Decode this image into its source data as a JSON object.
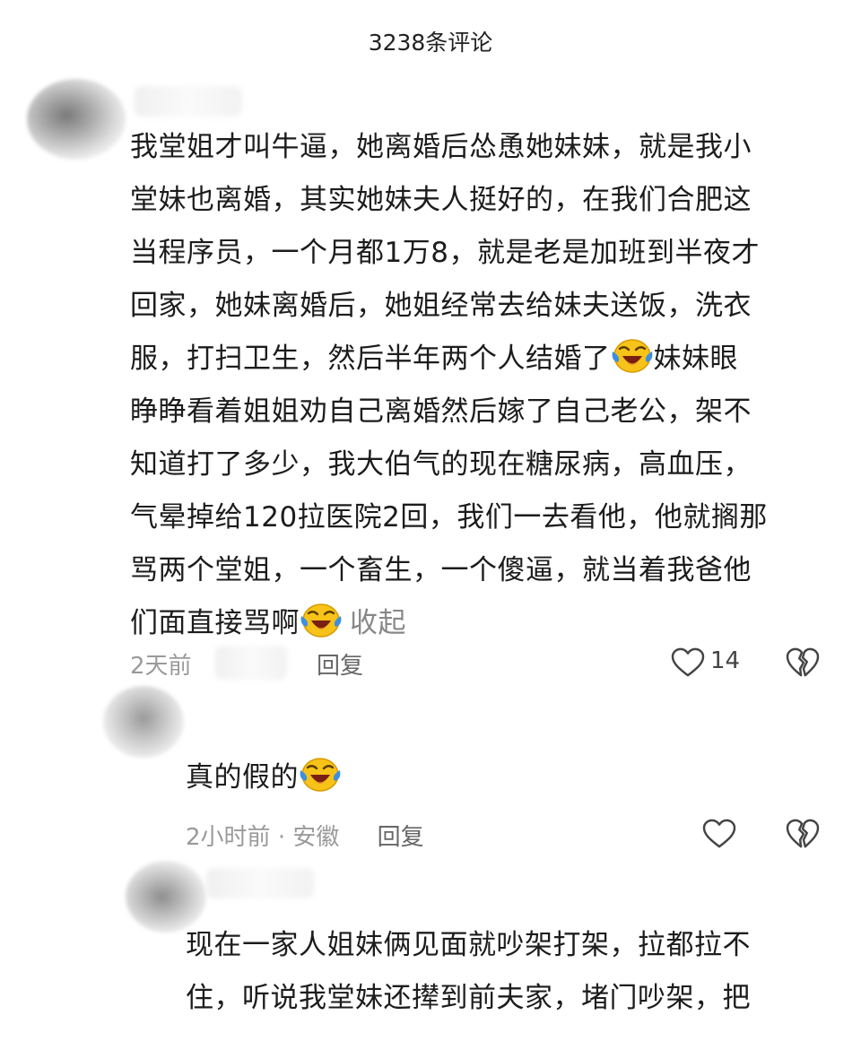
{
  "header": {
    "title": "3238条评论"
  },
  "comments": [
    {
      "lines": [
        "我堂姐才叫牛逼，她离婚后怂恿她妹妹，就是我小",
        "堂妹也离婚，其实她妹夫人挺好的，在我们合肥这",
        "当程序员，一个月都1万8，就是老是加班到半夜才",
        "回家，她妹离婚后，她姐经常去给妹夫送饭，洗衣",
        "服，打扫卫生，然后半年两个人结婚了",
        "妹妹眼",
        "睁睁看着姐姐劝自己离婚然后嫁了自己老公，架不",
        "知道打了多少，我大伯气的现在糖尿病，高血压，",
        "气晕掉给120拉医院2回，我们一去看他，他就搁那",
        "骂两个堂姐，一个畜生，一个傻逼，就当着我爸他",
        "们面直接骂啊"
      ],
      "collapse_label": "收起",
      "time": "2天前",
      "reply_label": "回复",
      "like_count": "14"
    },
    {
      "text": "真的假的",
      "time": "2小时前",
      "separator": "·",
      "location": "安徽",
      "reply_label": "回复"
    },
    {
      "lines": [
        "现在一家人姐妹俩见面就吵架打架，拉都拉不",
        "住，听说我堂妹还撵到前夫家，堵门吵架，把"
      ]
    }
  ],
  "icons": {
    "emoji": "laughing-crying-emoji",
    "like": "heart-outline-icon",
    "dislike": "broken-heart-icon"
  },
  "colors": {
    "emoji_yellow": "#f7c318",
    "emoji_tear": "#3d8fe0",
    "meta_gray": "#9a9a9a"
  }
}
